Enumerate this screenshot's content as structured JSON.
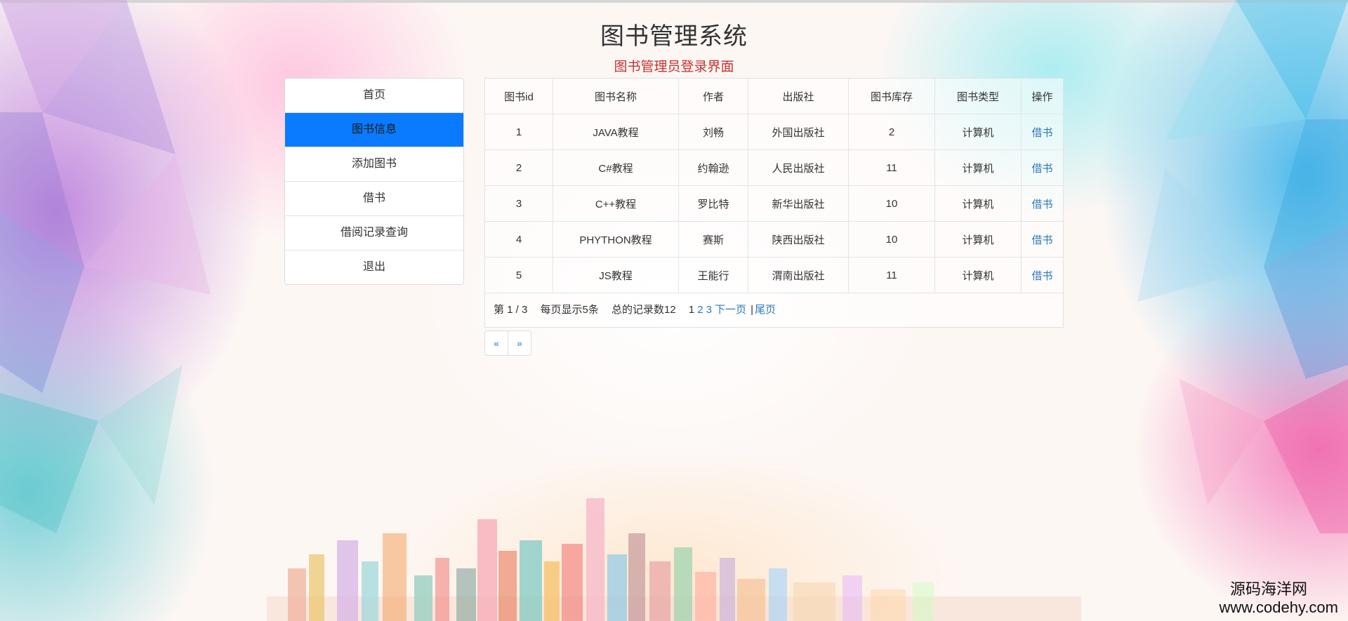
{
  "header": {
    "title": "图书管理系统",
    "subtitle": "图书管理员登录界面"
  },
  "sidebar": {
    "items": [
      {
        "label": "首页",
        "active": false
      },
      {
        "label": "图书信息",
        "active": true
      },
      {
        "label": "添加图书",
        "active": false
      },
      {
        "label": "借书",
        "active": false
      },
      {
        "label": "借阅记录查询",
        "active": false
      },
      {
        "label": "退出",
        "active": false
      }
    ]
  },
  "table": {
    "headers": [
      "图书id",
      "图书名称",
      "作者",
      "出版社",
      "图书库存",
      "图书类型",
      "操作"
    ],
    "rows": [
      {
        "id": "1",
        "name": "JAVA教程",
        "author": "刘畅",
        "publisher": "外国出版社",
        "stock": "2",
        "type": "计算机",
        "action": "借书"
      },
      {
        "id": "2",
        "name": "C#教程",
        "author": "约翰逊",
        "publisher": "人民出版社",
        "stock": "11",
        "type": "计算机",
        "action": "借书"
      },
      {
        "id": "3",
        "name": "C++教程",
        "author": "罗比特",
        "publisher": "新华出版社",
        "stock": "10",
        "type": "计算机",
        "action": "借书"
      },
      {
        "id": "4",
        "name": "PHYTHON教程",
        "author": "赛斯",
        "publisher": "陕西出版社",
        "stock": "10",
        "type": "计算机",
        "action": "借书"
      },
      {
        "id": "5",
        "name": "JS教程",
        "author": "王能行",
        "publisher": "渭南出版社",
        "stock": "11",
        "type": "计算机",
        "action": "借书"
      }
    ]
  },
  "pagination": {
    "page_info": "第 1 / 3",
    "per_page": "每页显示5条",
    "total": "总的记录数12",
    "pages": [
      "1",
      "2",
      "3"
    ],
    "next": "下一页",
    "separator": "|",
    "last": "尾页",
    "prev_arrow": "«",
    "next_arrow": "»"
  },
  "watermark": {
    "name": "源码海洋网",
    "url": "www.codehy.com"
  },
  "colors": {
    "active_nav": "#0a7bff",
    "link": "#2a7ab8",
    "subtitle": "#c9302c"
  }
}
